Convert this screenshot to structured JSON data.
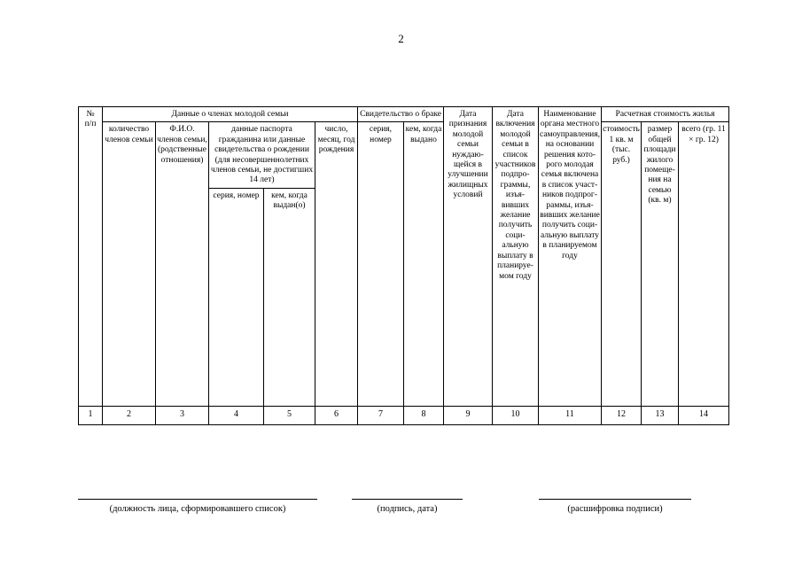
{
  "page": {
    "number": "2"
  },
  "table": {
    "group_headers": [
      {
        "label": "№ п/п",
        "line1": "№",
        "line2": "п/п"
      },
      {
        "label": "Данные о членах молодой семьи"
      },
      {
        "label": "Свидетельство о браке"
      },
      {
        "label": "Дата призна­ния молодой семьи нуждаю­щейся в улучше­нии жилищ­ных условий"
      },
      {
        "label": "Дата включе­ния моло­дой семьи в список участ­ников подпро­грам­мы, изъя­вивших жела­ние полу­чить соци­альную выпла­ту в пла­нируе­мом году"
      },
      {
        "label": "Наиме­нование органа местного само­управ­ления, на основа­нии реше­ния кото­рого молодая семья включена в список участ­ников подпрог­раммы, изъя­вивших желание получить соци­альную выплату в планируе­мом году"
      },
      {
        "label": "Расчетная стоимость жилья"
      }
    ],
    "sub_headers": {
      "col2": "коли­чество членов семьи",
      "col3": "Ф.И.О. членов семьи, (родствен­ные отно­шения)",
      "col4_5_group": "данные паспорта гражданина или данные свидетельства о рождении (для несовершеннолет­них членов семьи, не достигших 14 лет)",
      "col4": "серия, номер",
      "col5": "кем, когда выдан(о)",
      "col6": "число, месяц, год рожде­ния",
      "col7": "серия, номер",
      "col8": "кем, когда выда­но",
      "col12": "стои­мость 1 кв. м (тыс. руб.)",
      "col13": "раз­мер об­щей пло­ща­ди жи­лого по­ме­ще­ния на се­мью (кв. м)",
      "col14": "всего (гр. 11 × гр. 12)"
    },
    "column_numbers": [
      "1",
      "2",
      "3",
      "4",
      "5",
      "6",
      "7",
      "8",
      "9",
      "10",
      "11",
      "12",
      "13",
      "14"
    ]
  },
  "footer": {
    "signatures": [
      {
        "caption": "(должность лица, сформировавшего список)"
      },
      {
        "caption": "(подпись, дата)"
      },
      {
        "caption": "(расшифровка подписи)"
      }
    ]
  },
  "colors": {
    "page_background": "#ffffff",
    "text": "#000000",
    "rule": "#000000"
  }
}
